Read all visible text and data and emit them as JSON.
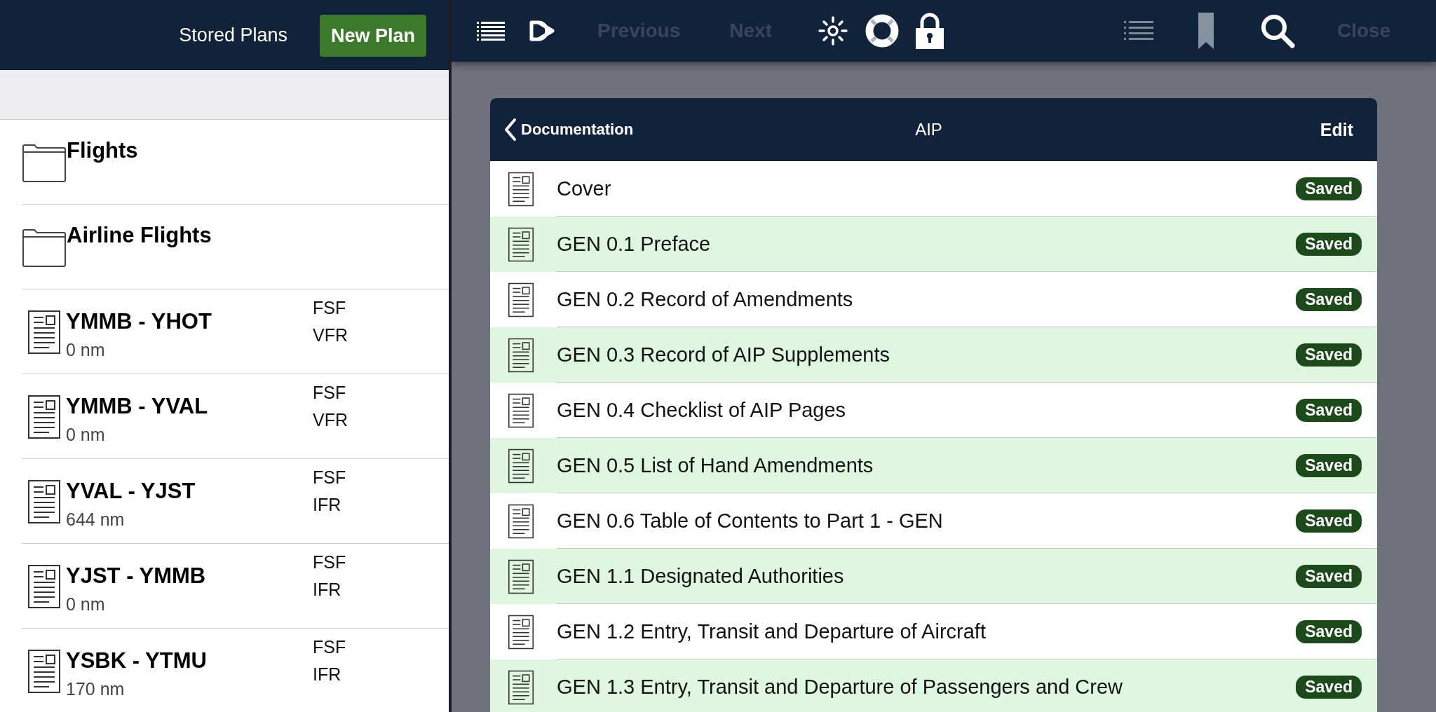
{
  "sidebar": {
    "title": "Stored Plans",
    "new_button": "New Plan",
    "items": [
      {
        "kind": "folder",
        "title": "Flights"
      },
      {
        "kind": "folder",
        "title": "Airline Flights"
      },
      {
        "kind": "plan",
        "title": "YMMB - YHOT",
        "distance": "0 nm",
        "tags": [
          "FSF",
          "VFR"
        ]
      },
      {
        "kind": "plan",
        "title": "YMMB - YVAL",
        "distance": "0 nm",
        "tags": [
          "FSF",
          "VFR"
        ]
      },
      {
        "kind": "plan",
        "title": "YVAL - YJST",
        "distance": "644 nm",
        "tags": [
          "FSF",
          "IFR"
        ]
      },
      {
        "kind": "plan",
        "title": "YJST - YMMB",
        "distance": "0 nm",
        "tags": [
          "FSF",
          "IFR"
        ]
      },
      {
        "kind": "plan",
        "title": "YSBK - YTMU",
        "distance": "170 nm",
        "tags": [
          "FSF",
          "IFR"
        ]
      }
    ]
  },
  "toolbar": {
    "previous": {
      "label": "Previous",
      "disabled": true
    },
    "next": {
      "label": "Next",
      "disabled": true
    },
    "close": {
      "label": "Close",
      "disabled": true
    }
  },
  "document_list": {
    "back_label": "Documentation",
    "title": "AIP",
    "edit_label": "Edit",
    "rows": [
      {
        "title": "Cover",
        "status": "Saved"
      },
      {
        "title": "GEN 0.1 Preface",
        "status": "Saved"
      },
      {
        "title": "GEN 0.2 Record of Amendments",
        "status": "Saved"
      },
      {
        "title": "GEN 0.3 Record of AIP Supplements",
        "status": "Saved"
      },
      {
        "title": "GEN 0.4 Checklist of AIP Pages",
        "status": "Saved"
      },
      {
        "title": "GEN 0.5 List of Hand Amendments",
        "status": "Saved"
      },
      {
        "title": "GEN 0.6 Table of Contents to Part 1 - GEN",
        "status": "Saved"
      },
      {
        "title": "GEN 1.1 Designated Authorities",
        "status": "Saved"
      },
      {
        "title": "GEN 1.2 Entry, Transit and Departure of Aircraft",
        "status": "Saved"
      },
      {
        "title": "GEN 1.3 Entry, Transit and Departure of Passengers and Crew",
        "status": "Saved"
      }
    ]
  }
}
